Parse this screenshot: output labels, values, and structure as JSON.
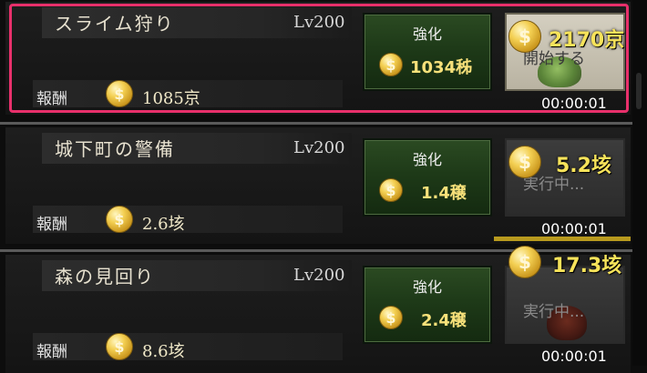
{
  "quests": [
    {
      "name": "スライム狩り",
      "level": "Lv200",
      "reward_label": "報酬",
      "reward": "1085京",
      "upgrade_label": "強化",
      "upgrade_cost": "1034秭",
      "action_label": "開始する",
      "action_state": "start",
      "cost": "2170京",
      "timer": "00:00:01",
      "selected": true
    },
    {
      "name": "城下町の警備",
      "level": "Lv200",
      "reward_label": "報酬",
      "reward": "2.6垓",
      "upgrade_label": "強化",
      "upgrade_cost": "1.4穣",
      "action_label": "実行中...",
      "action_state": "running",
      "cost": "5.2垓",
      "timer": "00:00:01",
      "selected": false
    },
    {
      "name": "森の見回り",
      "level": "Lv200",
      "reward_label": "報酬",
      "reward": "8.6垓",
      "upgrade_label": "強化",
      "upgrade_cost": "2.4穣",
      "action_label": "実行中...",
      "action_state": "running",
      "cost": "17.3垓",
      "timer": "00:00:01",
      "selected": false
    }
  ],
  "icons": {
    "coin": "gold-coin-icon",
    "coin_symbol": "$"
  },
  "colors": {
    "highlight": "#e8306b",
    "cost_text": "#f7e35a",
    "upgrade_button": "#1e3a18"
  }
}
